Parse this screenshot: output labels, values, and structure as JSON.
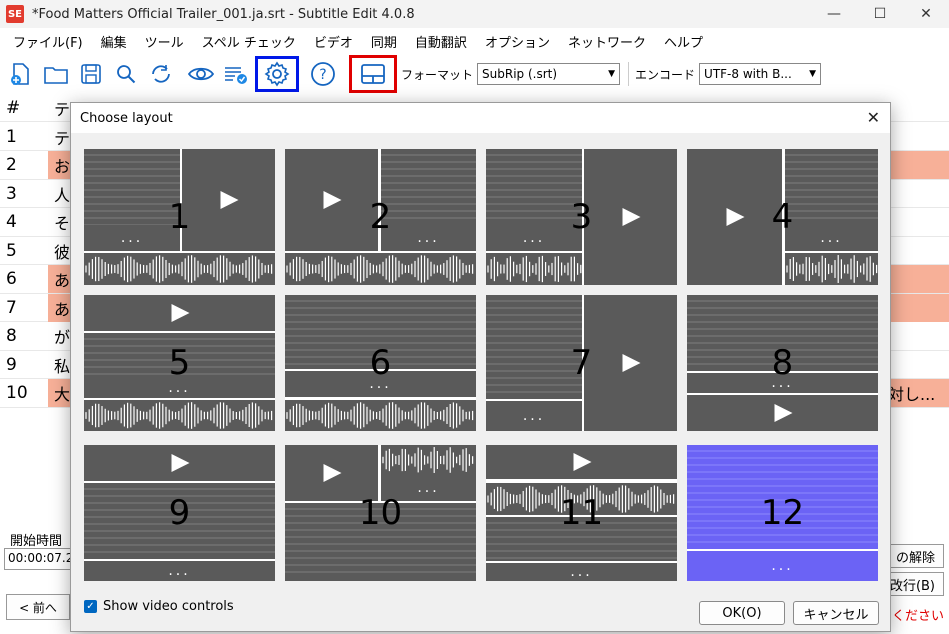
{
  "window": {
    "title": "*Food Matters Official Trailer_001.ja.srt - Subtitle Edit 4.0.8",
    "app_icon_text": "SE"
  },
  "menu": [
    "ファイル(F)",
    "編集",
    "ツール",
    "スペル チェック",
    "ビデオ",
    "同期",
    "自動翻訳",
    "オプション",
    "ネットワーク",
    "ヘルプ"
  ],
  "toolbar": {
    "format_label": "フォーマット",
    "format_value": "SubRip (.srt)",
    "encoding_label": "エンコード",
    "encoding_value": "UTF-8 with B..."
  },
  "grid": {
    "col_num": "#",
    "col_text": "テ",
    "rows": [
      {
        "n": "1",
        "t": "テ"
      },
      {
        "n": "2",
        "t": "お"
      },
      {
        "n": "3",
        "t": "人"
      },
      {
        "n": "4",
        "t": "そ"
      },
      {
        "n": "5",
        "t": "彼"
      },
      {
        "n": "6",
        "t": "あ"
      },
      {
        "n": "7",
        "t": "あ"
      },
      {
        "n": "8",
        "t": "が"
      },
      {
        "n": "9",
        "t": "私"
      },
      {
        "n": "10",
        "t": "大",
        "right": "対し..."
      }
    ]
  },
  "bottom": {
    "start_time_label": "開始時間",
    "start_time_value": "00:00:07.2",
    "prev_button": "< 前へ",
    "right_btn1": "の解除",
    "right_btn2": "改行(B)",
    "right_text": "てください"
  },
  "dialog": {
    "title": "Choose layout",
    "tiles": [
      "1",
      "2",
      "3",
      "4",
      "5",
      "6",
      "7",
      "8",
      "9",
      "10",
      "11",
      "12"
    ],
    "selected": "12",
    "show_video_controls": "Show video controls",
    "ok": "OK(O)",
    "cancel": "キャンセル"
  },
  "colors": {
    "tile_dark": "#5a5a5a",
    "tile_selected": "#6b63f5",
    "row_highlight": "#f7b098",
    "highlight_blue": "#0018e8",
    "highlight_red": "#e00000"
  }
}
